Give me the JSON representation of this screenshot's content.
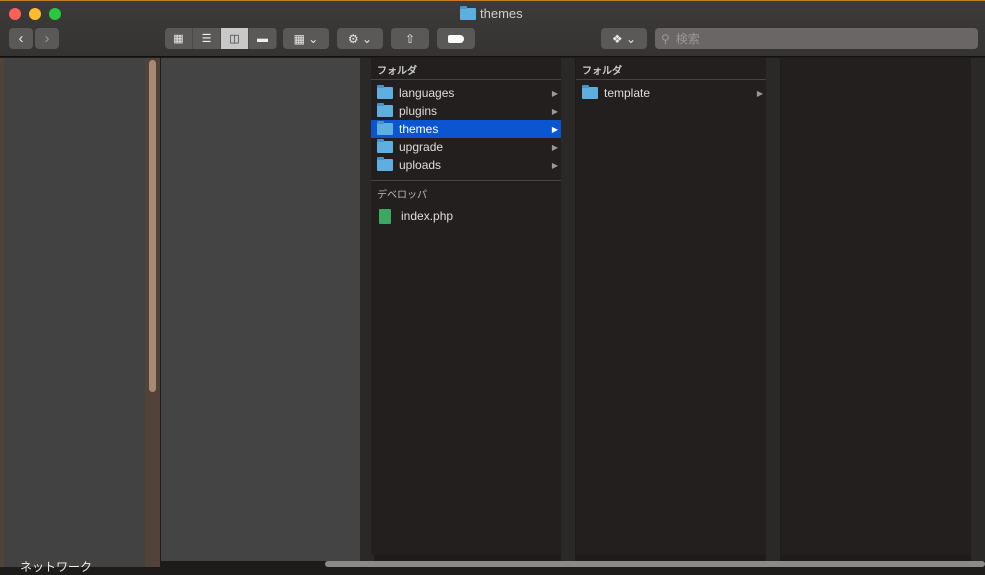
{
  "window": {
    "title": "themes"
  },
  "toolbar": {
    "search_placeholder": "検索",
    "views": [
      "icon",
      "list",
      "column",
      "gallery"
    ],
    "active_view": "column"
  },
  "sidebar": {
    "network_label": "ネットワーク"
  },
  "columns": [
    {
      "header": "フォルダ",
      "items": [
        {
          "name": "languages",
          "selected": false
        },
        {
          "name": "plugins",
          "selected": false
        },
        {
          "name": "themes",
          "selected": true
        },
        {
          "name": "upgrade",
          "selected": false
        },
        {
          "name": "uploads",
          "selected": false
        }
      ],
      "section2": "デベロッパ",
      "files": [
        "index.php"
      ]
    },
    {
      "header": "フォルダ",
      "items": [
        {
          "name": "template",
          "selected": false
        }
      ]
    }
  ],
  "colors": {
    "selection": "#0b56d0",
    "folder": "#5eaee0"
  }
}
